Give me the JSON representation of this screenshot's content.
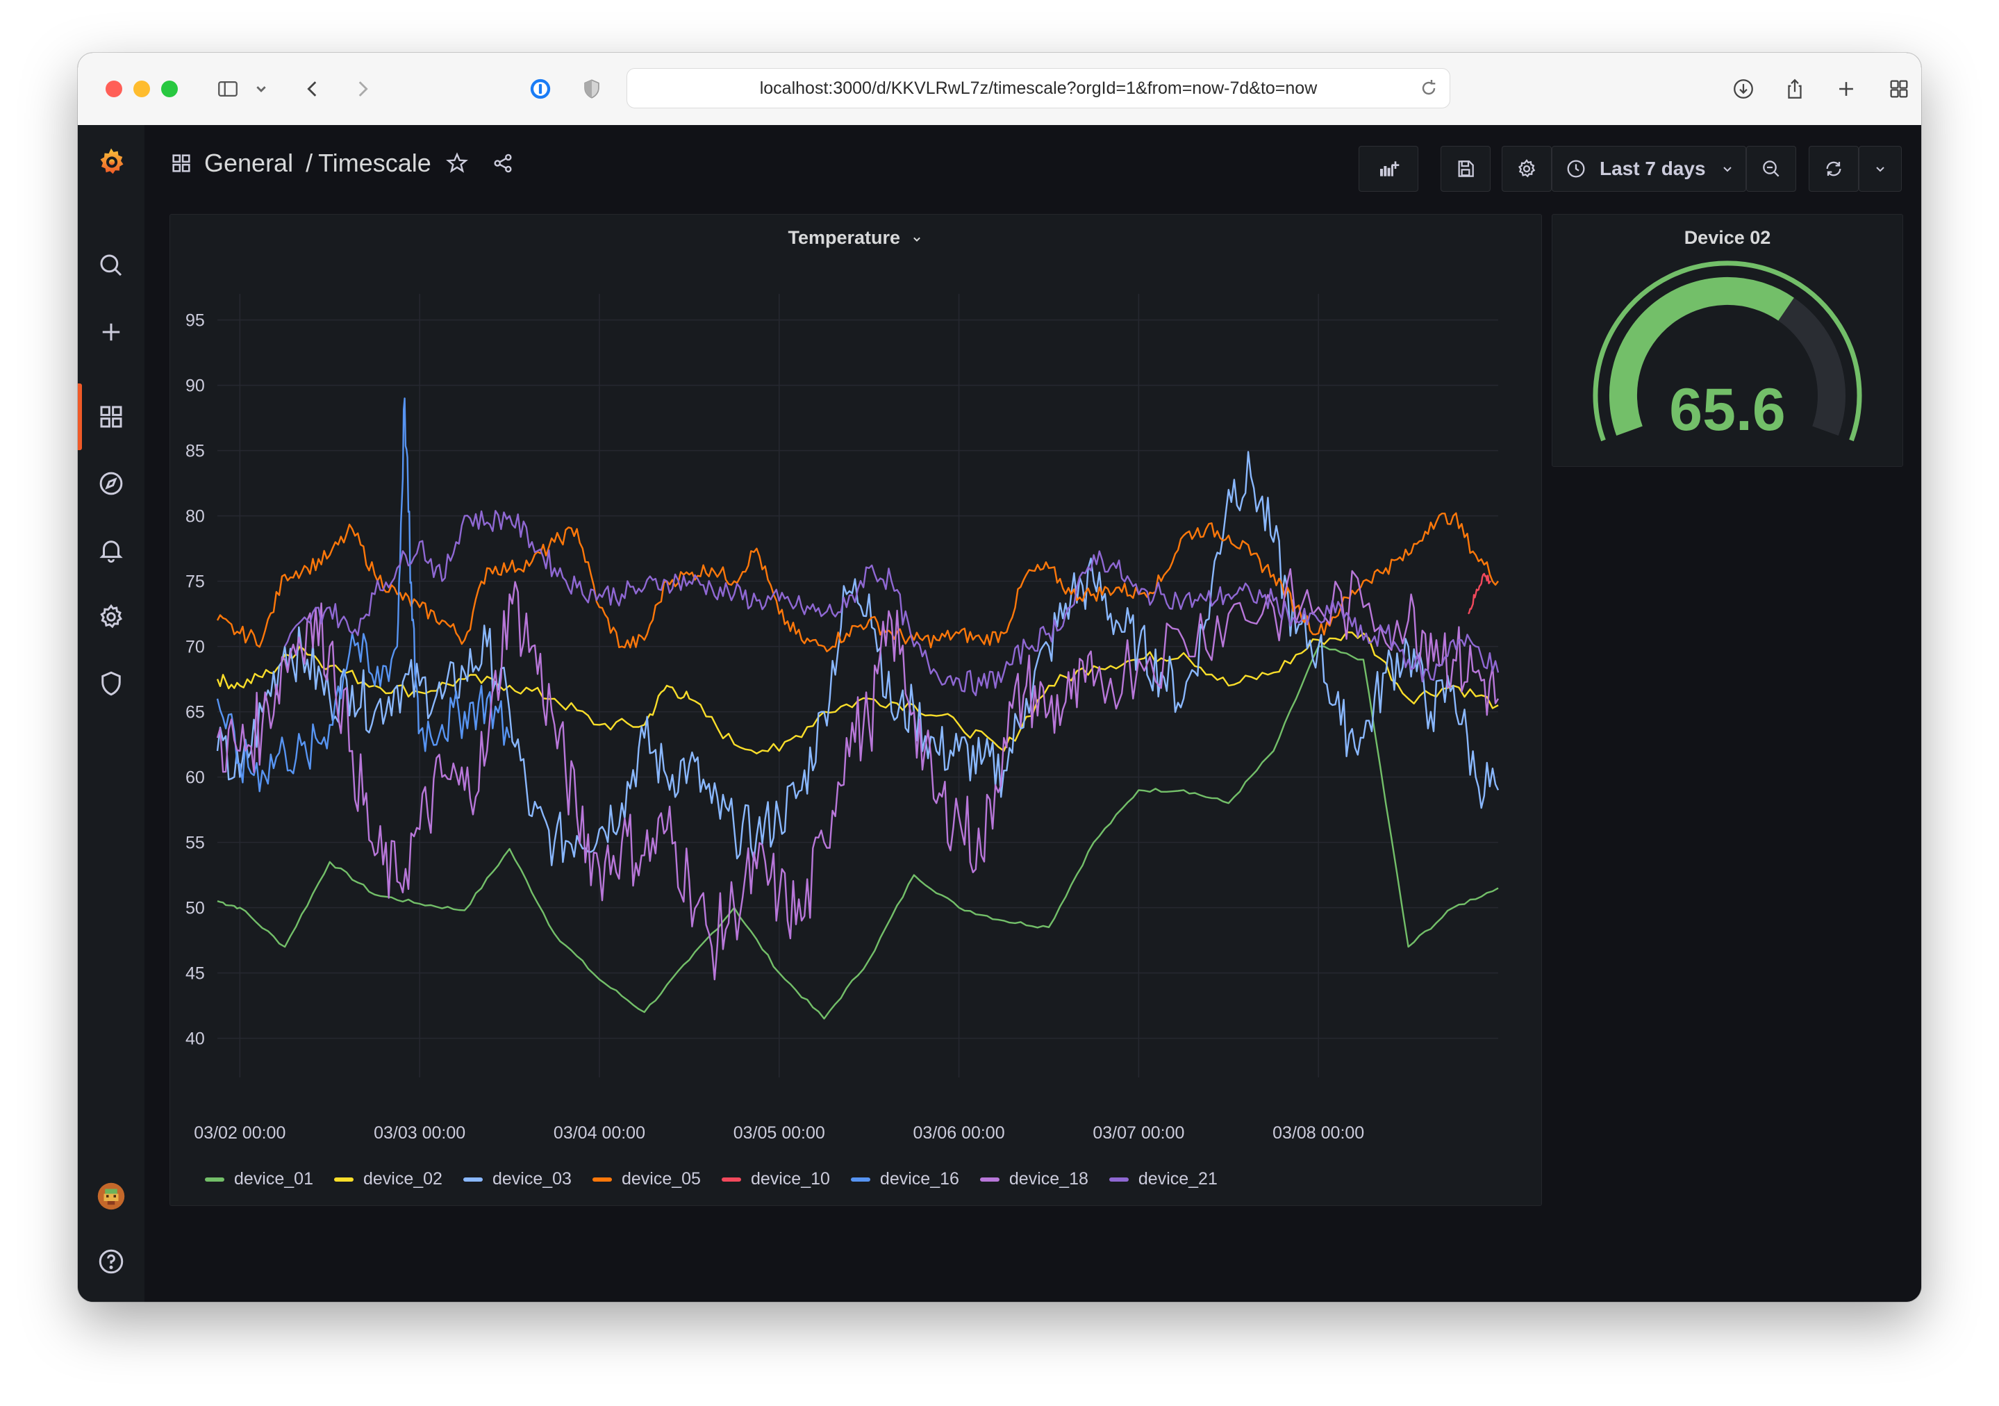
{
  "browser": {
    "url": "localhost:3000/d/KKVLRwL7z/timescale?orgId=1&from=now-7d&to=now",
    "traffic_colors": [
      "#ff5f57",
      "#febc2e",
      "#28c840"
    ]
  },
  "sidebar": {
    "items": [
      "grafana-logo-icon",
      "search-icon",
      "plus-icon",
      "dashboards-icon",
      "explore-icon",
      "alerting-icon",
      "settings-icon",
      "shield-icon",
      "avatar",
      "help-icon"
    ],
    "active": "dashboards-icon",
    "accent": "#f05a28"
  },
  "breadcrumb": {
    "folder": "General",
    "separator": "/",
    "dashboard": "Timescale"
  },
  "toolbar": {
    "time_range": "Last 7 days"
  },
  "temperature_panel": {
    "title": "Temperature"
  },
  "gauge_panel": {
    "title": "Device 02",
    "value": "65.6",
    "value_num": 65.6,
    "min": 0,
    "max": 100,
    "color": "#73bf69"
  },
  "chart_data": {
    "type": "line",
    "title": "Temperature",
    "ylim": [
      37,
      97
    ],
    "yticks": [
      40,
      45,
      50,
      55,
      60,
      65,
      70,
      75,
      80,
      85,
      90,
      95
    ],
    "x_range": [
      "03/01 21:00",
      "03/08 21:00"
    ],
    "xtick_labels": [
      "03/02 00:00",
      "03/03 00:00",
      "03/04 00:00",
      "03/05 00:00",
      "03/06 00:00",
      "03/07 00:00",
      "03/08 00:00"
    ],
    "x_unit": "hours since 03/02 00:00",
    "grid": true,
    "legend_position": "bottom",
    "series": [
      {
        "name": "device_01",
        "color": "#73bf69",
        "x": [
          -3,
          0,
          6,
          12,
          18,
          24,
          30,
          36,
          42,
          48,
          54,
          60,
          66,
          72,
          78,
          84,
          90,
          96,
          102,
          108,
          114,
          120,
          126,
          132,
          138,
          144,
          150,
          156,
          162,
          168
        ],
        "y": [
          50.5,
          50,
          47,
          53.5,
          51,
          50.3,
          49.8,
          54.5,
          48,
          44.5,
          42,
          46,
          50,
          45,
          41.5,
          46,
          52.5,
          50,
          49,
          48.5,
          55,
          59,
          59,
          58,
          62,
          70,
          69,
          47,
          50,
          51.5
        ]
      },
      {
        "name": "device_02",
        "color": "#fade2a",
        "x": [
          -3,
          0,
          4,
          8,
          12,
          18,
          24,
          30,
          36,
          42,
          48,
          54,
          57,
          60,
          66,
          72,
          78,
          84,
          90,
          96,
          102,
          108,
          114,
          120,
          126,
          132,
          138,
          144,
          150,
          156,
          162,
          168
        ],
        "y": [
          67.5,
          67,
          68,
          70,
          68.5,
          67,
          66.5,
          67.5,
          67,
          66,
          64,
          64,
          67,
          66,
          62.5,
          62,
          65,
          66,
          65.5,
          64,
          62,
          67,
          68.5,
          69,
          69.5,
          67,
          68,
          70.5,
          71,
          66,
          67,
          65.5
        ]
      },
      {
        "name": "device_03",
        "color": "#8ab8ff",
        "x": [
          -3,
          0,
          3,
          6,
          9,
          12,
          15,
          18,
          21,
          24,
          27,
          30,
          33,
          36,
          39,
          42,
          45,
          48,
          51,
          54,
          57,
          60,
          63,
          66,
          69,
          72,
          75,
          78,
          81,
          84,
          87,
          90,
          93,
          96,
          99,
          102,
          105,
          108,
          111,
          114,
          117,
          120,
          123,
          126,
          129,
          132,
          135,
          138,
          141,
          144,
          147,
          150,
          153,
          156,
          159,
          162,
          165,
          168
        ],
        "y": [
          62,
          60,
          65,
          70,
          69,
          66,
          67,
          65,
          67,
          67,
          66,
          68,
          70,
          65,
          57,
          55,
          55.5,
          56,
          58,
          63,
          60,
          61,
          58,
          56,
          55.5,
          57,
          59,
          65,
          74,
          74,
          65,
          65,
          62,
          62,
          61,
          60.5,
          66,
          70,
          74,
          75,
          72,
          70,
          68,
          66,
          72,
          82,
          83,
          78,
          71,
          70,
          64,
          63,
          68,
          70,
          65,
          67,
          60,
          59
        ]
      },
      {
        "name": "device_05",
        "color": "#ff780a",
        "x": [
          -3,
          0,
          3,
          6,
          9,
          12,
          15,
          18,
          21,
          24,
          27,
          30,
          33,
          36,
          39,
          42,
          45,
          48,
          51,
          54,
          57,
          60,
          63,
          66,
          69,
          72,
          75,
          78,
          81,
          84,
          87,
          90,
          93,
          96,
          99,
          102,
          105,
          108,
          111,
          114,
          117,
          120,
          123,
          126,
          129,
          132,
          135,
          138,
          141,
          144,
          147,
          150,
          153,
          156,
          159,
          162,
          165,
          168
        ],
        "y": [
          72,
          71,
          70.5,
          75.5,
          76,
          77,
          79,
          75.5,
          74,
          73,
          72,
          70.5,
          76,
          76,
          76.5,
          78,
          79,
          73,
          70,
          70.5,
          75,
          75.5,
          76,
          75,
          77.5,
          72.5,
          70.5,
          70,
          71,
          72,
          71,
          70.5,
          70.5,
          71,
          70.5,
          71,
          75.5,
          76,
          74,
          74,
          74.5,
          74,
          75,
          78.5,
          79,
          78.5,
          77,
          75.5,
          73,
          71,
          73,
          75,
          76,
          77,
          79.5,
          80,
          77,
          75
        ]
      },
      {
        "name": "device_10",
        "color": "#f2495c",
        "x": [
          164,
          165,
          166,
          167
        ],
        "y": [
          72.5,
          74,
          75.5,
          75
        ]
      },
      {
        "name": "device_16",
        "color": "#5794f2",
        "x": [
          -3,
          0,
          3,
          6,
          9,
          12,
          15,
          18,
          21,
          22,
          23,
          24,
          27,
          30,
          33,
          36
        ],
        "y": [
          66,
          61,
          60.5,
          62,
          61.5,
          64,
          71,
          67,
          70,
          89,
          72,
          63.5,
          64,
          65,
          66,
          63
        ]
      },
      {
        "name": "device_18",
        "color": "#b877d9",
        "x": [
          -3,
          0,
          3,
          6,
          9,
          12,
          15,
          18,
          21,
          24,
          27,
          30,
          33,
          36,
          39,
          42,
          45,
          48,
          51,
          54,
          57,
          60,
          63,
          66,
          69,
          72,
          75,
          78,
          81,
          84,
          87,
          90,
          93,
          96,
          99,
          102,
          105,
          108,
          111,
          114,
          120,
          126,
          132,
          138,
          144,
          150,
          156,
          159,
          162,
          165,
          168
        ],
        "y": [
          63,
          62,
          64,
          69,
          72,
          70,
          62,
          54,
          52,
          56,
          60,
          59,
          62,
          74,
          70,
          64,
          57,
          53,
          55,
          54,
          56,
          52,
          47,
          50,
          53,
          51,
          49,
          55,
          63,
          64,
          72,
          65,
          58,
          57,
          54,
          63,
          67,
          65,
          66,
          67,
          69,
          70.5,
          72.5,
          73,
          73,
          73,
          72,
          71,
          69,
          68,
          66
        ]
      },
      {
        "name": "device_21",
        "color": "#8f68d3",
        "x": [
          6,
          9,
          12,
          15,
          18,
          21,
          24,
          27,
          30,
          33,
          36,
          39,
          42,
          45,
          48,
          51,
          54,
          57,
          60,
          63,
          66,
          69,
          72,
          75,
          78,
          81,
          84,
          87,
          90,
          93,
          96,
          99,
          102,
          105,
          108,
          111,
          114,
          117,
          120,
          123,
          126,
          129,
          132,
          135,
          138,
          141,
          144,
          147,
          150,
          153,
          156,
          159,
          162,
          165,
          168
        ],
        "y": [
          70,
          72,
          73,
          71,
          74,
          76,
          78,
          75,
          80,
          79.5,
          80,
          78,
          76,
          74.5,
          74,
          74,
          74.5,
          75,
          75,
          74.5,
          74,
          73.5,
          73.5,
          73,
          72.5,
          73,
          76,
          75,
          70,
          68,
          67.5,
          67,
          68,
          70,
          71,
          73,
          77,
          76,
          74,
          74,
          73.5,
          73.5,
          74,
          74,
          73.5,
          72,
          72,
          73,
          70.5,
          71,
          69,
          67.5,
          70.5,
          70,
          68
        ]
      }
    ]
  }
}
